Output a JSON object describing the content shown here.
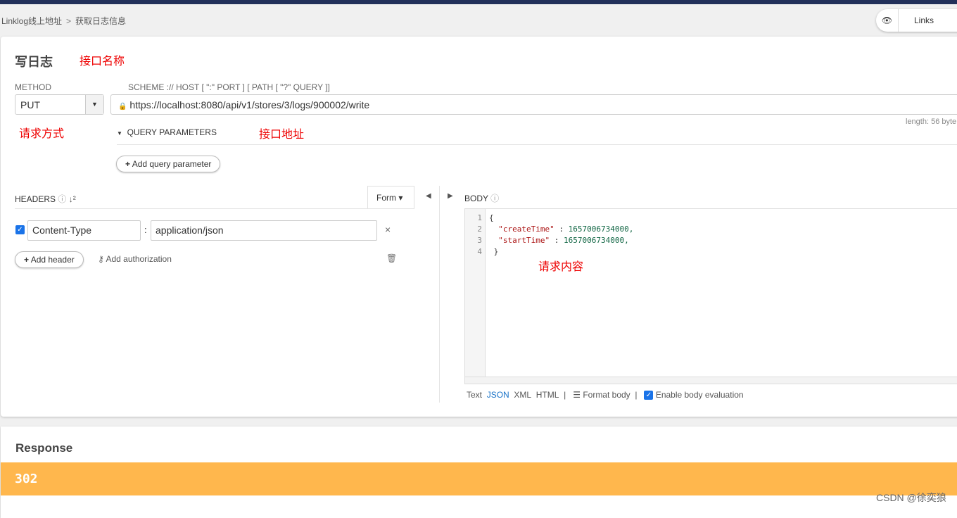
{
  "breadcrumb": {
    "parent": "Linklog线上地址",
    "current": "获取日志信息"
  },
  "links_label": "Links",
  "request": {
    "title": "写日志",
    "annotations": {
      "name": "接口名称",
      "method": "请求方式",
      "url": "接口地址",
      "body": "请求内容"
    },
    "method_label": "METHOD",
    "method_value": "PUT",
    "url_label": "SCHEME :// HOST [ \":\" PORT ] [ PATH [ \"?\" QUERY ]]",
    "url_value": "https://localhost:8080/api/v1/stores/3/logs/900002/write",
    "length": "length: 56 byte",
    "query_params_label": "QUERY PARAMETERS",
    "add_query_label": "Add query parameter",
    "headers_label": "HEADERS",
    "form_label": "Form",
    "headers": [
      {
        "name": "Content-Type",
        "value": "application/json",
        "enabled": true
      }
    ],
    "add_header_label": "Add header",
    "add_auth_label": "Add authorization",
    "body_label": "BODY",
    "body_lines": [
      "1",
      "2",
      "3",
      "4"
    ],
    "body": {
      "l1": "{",
      "k1": "\"createTime\"",
      "v1": "1657006734000,",
      "k2": "\"startTime\"",
      "v2": "1657006734000,",
      "l4": "}"
    },
    "body_formats": [
      "Text",
      "JSON",
      "XML",
      "HTML"
    ],
    "format_body_label": "Format body",
    "enable_eval_label": "Enable body evaluation"
  },
  "response": {
    "title": "Response",
    "status": "302",
    "status_color": "#ffb74d"
  },
  "watermark": "CSDN @徐奕狼"
}
